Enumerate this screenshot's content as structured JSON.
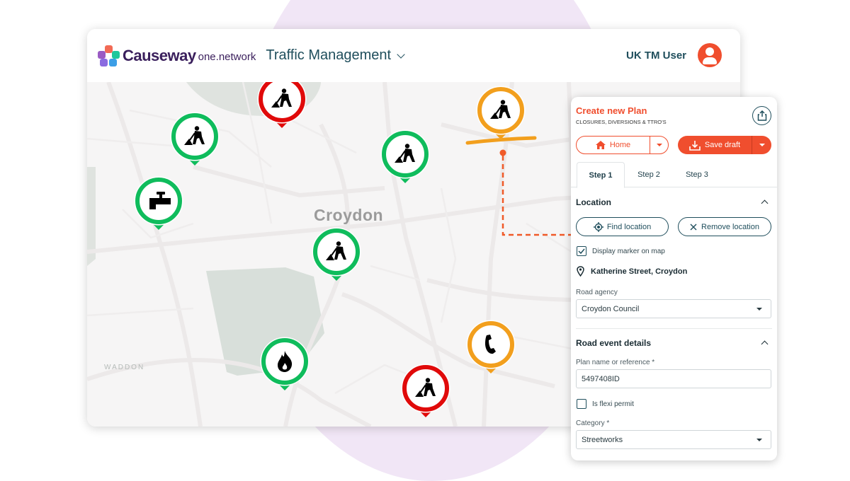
{
  "header": {
    "brand_name": "Causeway",
    "brand_sub": "one.network",
    "app_title": "Traffic Management",
    "user_name": "UK TM User"
  },
  "map": {
    "city_label": "Croydon",
    "district_label": "WADDON",
    "markers": [
      {
        "type": "roadworks",
        "status": "red",
        "color": "#e00a0a"
      },
      {
        "type": "roadworks",
        "status": "green",
        "color": "#0fbc5c"
      },
      {
        "type": "roadworks",
        "status": "green",
        "color": "#0fbc5c"
      },
      {
        "type": "water",
        "status": "green",
        "color": "#0fbc5c"
      },
      {
        "type": "roadworks",
        "status": "green",
        "color": "#0fbc5c"
      },
      {
        "type": "roadworks",
        "status": "amber",
        "color": "#f29f1d"
      },
      {
        "type": "gas",
        "status": "green",
        "color": "#0fbc5c"
      },
      {
        "type": "telecom",
        "status": "amber",
        "color": "#f29f1d"
      },
      {
        "type": "roadworks",
        "status": "red",
        "color": "#e00a0a"
      }
    ]
  },
  "panel": {
    "title": "Create new Plan",
    "subtitle": "CLOSURES, DIVERSIONS & TTRO'S",
    "home_label": "Home",
    "save_label": "Save draft",
    "tabs": [
      {
        "label": "Step 1",
        "active": true
      },
      {
        "label": "Step 2",
        "active": false
      },
      {
        "label": "Step 3",
        "active": false
      }
    ],
    "location": {
      "title": "Location",
      "find_label": "Find location",
      "remove_label": "Remove location",
      "display_marker_label": "Display marker on map",
      "display_marker_checked": true,
      "address": "Katherine Street, Croydon",
      "road_agency_label": "Road agency",
      "road_agency_value": "Croydon Council"
    },
    "event": {
      "title": "Road event details",
      "plan_name_label": "Plan name or reference *",
      "plan_name_value": "5497408ID",
      "flexi_label": "Is flexi permit",
      "flexi_checked": false,
      "category_label": "Category *",
      "category_value": "Streetworks"
    }
  },
  "colors": {
    "accent": "#f04e2e",
    "teal": "#1f4e5c",
    "green": "#0fbc5c",
    "red": "#e00a0a",
    "amber": "#f29f1d"
  }
}
